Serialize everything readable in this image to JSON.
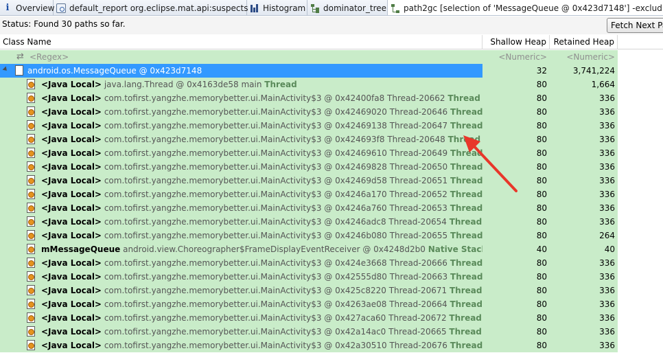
{
  "tabs": [
    {
      "label": "Overview",
      "icon": "info-icon"
    },
    {
      "label": "default_report  org.eclipse.mat.api:suspects",
      "icon": "report-icon"
    },
    {
      "label": "Histogram",
      "icon": "histogram-icon"
    },
    {
      "label": "dominator_tree",
      "icon": "dominator-tree-icon"
    },
    {
      "label": "path2gc [selection of 'MessageQueue @ 0x423d7148'] -exclud",
      "icon": "path-icon"
    }
  ],
  "status": {
    "text": "Status:  Found 30 paths so far."
  },
  "fetch_button": {
    "label": "Fetch Next Pa"
  },
  "columns": {
    "name": "Class Name",
    "shallow": "Shallow Heap",
    "retained": "Retained Heap"
  },
  "filter_row": {
    "name": "<Regex>",
    "shallow": "<Numeric>",
    "retained": "<Numeric>"
  },
  "root_row": {
    "name": "android.os.MessageQueue @ 0x423d7148",
    "shallow": "32",
    "retained": "3,741,224"
  },
  "rows": [
    {
      "kind": "<Java Local>",
      "object": "java.lang.Thread @ 0x4163de58  main",
      "tail": "Thread",
      "shallow": "80",
      "retained": "1,664"
    },
    {
      "kind": "<Java Local>",
      "object": "com.tofirst.yangzhe.memorybetter.ui.MainActivity$3 @ 0x42400fa8  Thread-20662",
      "tail": "Thread",
      "shallow": "80",
      "retained": "336"
    },
    {
      "kind": "<Java Local>",
      "object": "com.tofirst.yangzhe.memorybetter.ui.MainActivity$3 @ 0x42469020  Thread-20646",
      "tail": "Thread",
      "shallow": "80",
      "retained": "336"
    },
    {
      "kind": "<Java Local>",
      "object": "com.tofirst.yangzhe.memorybetter.ui.MainActivity$3 @ 0x42469138  Thread-20647",
      "tail": "Thread",
      "shallow": "80",
      "retained": "336"
    },
    {
      "kind": "<Java Local>",
      "object": "com.tofirst.yangzhe.memorybetter.ui.MainActivity$3 @ 0x424693f8  Thread-20648",
      "tail": "Thread",
      "shallow": "80",
      "retained": "336"
    },
    {
      "kind": "<Java Local>",
      "object": "com.tofirst.yangzhe.memorybetter.ui.MainActivity$3 @ 0x42469610  Thread-20649",
      "tail": "Thread",
      "shallow": "80",
      "retained": "336"
    },
    {
      "kind": "<Java Local>",
      "object": "com.tofirst.yangzhe.memorybetter.ui.MainActivity$3 @ 0x42469828  Thread-20650",
      "tail": "Thread",
      "shallow": "80",
      "retained": "336"
    },
    {
      "kind": "<Java Local>",
      "object": "com.tofirst.yangzhe.memorybetter.ui.MainActivity$3 @ 0x42469d58  Thread-20651",
      "tail": "Thread",
      "shallow": "80",
      "retained": "336"
    },
    {
      "kind": "<Java Local>",
      "object": "com.tofirst.yangzhe.memorybetter.ui.MainActivity$3 @ 0x4246a170  Thread-20652",
      "tail": "Thread",
      "shallow": "80",
      "retained": "336"
    },
    {
      "kind": "<Java Local>",
      "object": "com.tofirst.yangzhe.memorybetter.ui.MainActivity$3 @ 0x4246a760  Thread-20653",
      "tail": "Thread",
      "shallow": "80",
      "retained": "336"
    },
    {
      "kind": "<Java Local>",
      "object": "com.tofirst.yangzhe.memorybetter.ui.MainActivity$3 @ 0x4246adc8  Thread-20654",
      "tail": "Thread",
      "shallow": "80",
      "retained": "336"
    },
    {
      "kind": "<Java Local>",
      "object": "com.tofirst.yangzhe.memorybetter.ui.MainActivity$3 @ 0x4246b080  Thread-20655",
      "tail": "Thread",
      "shallow": "80",
      "retained": "264"
    },
    {
      "kind": "mMessageQueue",
      "object": "android.view.Choreographer$FrameDisplayEventReceiver @ 0x4248d2b0",
      "tail": "Native Stack",
      "shallow": "40",
      "retained": "40"
    },
    {
      "kind": "<Java Local>",
      "object": "com.tofirst.yangzhe.memorybetter.ui.MainActivity$3 @ 0x424e3668  Thread-20666",
      "tail": "Thread",
      "shallow": "80",
      "retained": "336"
    },
    {
      "kind": "<Java Local>",
      "object": "com.tofirst.yangzhe.memorybetter.ui.MainActivity$3 @ 0x42555d80  Thread-20663",
      "tail": "Thread",
      "shallow": "80",
      "retained": "336"
    },
    {
      "kind": "<Java Local>",
      "object": "com.tofirst.yangzhe.memorybetter.ui.MainActivity$3 @ 0x425c8220  Thread-20671",
      "tail": "Thread",
      "shallow": "80",
      "retained": "336"
    },
    {
      "kind": "<Java Local>",
      "object": "com.tofirst.yangzhe.memorybetter.ui.MainActivity$3 @ 0x4263ae08  Thread-20664",
      "tail": "Thread",
      "shallow": "80",
      "retained": "336"
    },
    {
      "kind": "<Java Local>",
      "object": "com.tofirst.yangzhe.memorybetter.ui.MainActivity$3 @ 0x427aca60  Thread-20672",
      "tail": "Thread",
      "shallow": "80",
      "retained": "336"
    },
    {
      "kind": "<Java Local>",
      "object": "com.tofirst.yangzhe.memorybetter.ui.MainActivity$3 @ 0x42a14ac0  Thread-20665",
      "tail": "Thread",
      "shallow": "80",
      "retained": "336"
    },
    {
      "kind": "<Java Local>",
      "object": "com.tofirst.yangzhe.memorybetter.ui.MainActivity$3 @ 0x42a30510  Thread-20676",
      "tail": "Thread",
      "shallow": "80",
      "retained": "336"
    }
  ],
  "colors": {
    "row_bg": "#c9ecc9",
    "selection": "#3399ff",
    "thread_tag": "#5a8a5a",
    "annotation_arrow": "#e8372a"
  }
}
